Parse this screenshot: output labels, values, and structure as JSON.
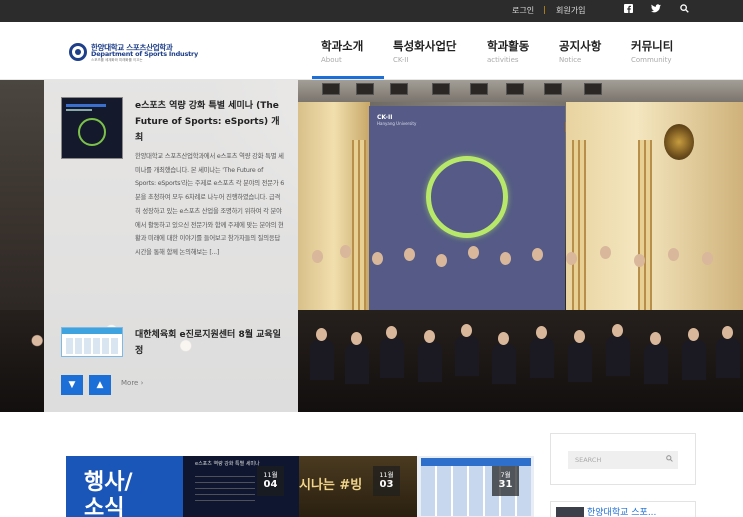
{
  "topbar": {
    "login": "로그인",
    "separator": "|",
    "signup": "회원가입",
    "icons": [
      "facebook-icon",
      "twitter-icon",
      "search-icon"
    ]
  },
  "logo": {
    "korean": "한양대학교 스포츠산업학과",
    "english": "Department of Sports Industry",
    "tagline": "스포츠를 세계화와 미래화를 이끄는"
  },
  "nav": [
    {
      "ko": "학과소개",
      "en": "About"
    },
    {
      "ko": "특성화사업단",
      "en": "CK-II"
    },
    {
      "ko": "학과활동",
      "en": "activities"
    },
    {
      "ko": "공지사항",
      "en": "Notice"
    },
    {
      "ko": "커뮤니티",
      "en": "Community"
    }
  ],
  "hero": {
    "screen_logo": "CK-II",
    "screen_sub": "Hanyang University"
  },
  "posts": [
    {
      "title": "e스포츠 역량 강화 특별 세미나 (The Future of Sports: eSports) 개최",
      "excerpt": "한양대학교 스포츠산업학과에서 e스포츠 역량 강화 특별 세미나를 개최했습니다. 본 세미나는 'The Future of Sports: eSports'라는 주제로 e스포츠 각 분야의 전문가 6분을 초청하여 모두 6차례로 나누어 진행하였습니다. 급격히 성장하고 있는 e스포츠 산업을 조명하기 위하여 각 분야에서 활동하고 있으신 전문가와 함께 주제에 맞는 분야의 현황과 미래에 대한 이야기를 들어보고 참가자들의 질의응답 시간을 통해 함께 논의해보는 [...]"
    },
    {
      "title": "대한체육회 e진로지원센터 8월 교육일정"
    }
  ],
  "controls": {
    "prev": "▼",
    "next": "▲",
    "more": "More ›"
  },
  "tiles": {
    "main_text": "행사/\n소식",
    "tile2_title": "e스포츠 역량 강화 특별 세미나",
    "tile3_text": "시나는 #빙",
    "dates": [
      {
        "month": "11월",
        "day": "04"
      },
      {
        "month": "11월",
        "day": "03"
      },
      {
        "month": "7월",
        "day": "31"
      }
    ]
  },
  "sidebar": {
    "search_placeholder": "SEARCH",
    "widget_text": "한양대학교 스포..."
  },
  "colors": {
    "accent": "#1d6fd8",
    "brand": "#1e3f8a",
    "topbar": "#2c2c2c"
  }
}
